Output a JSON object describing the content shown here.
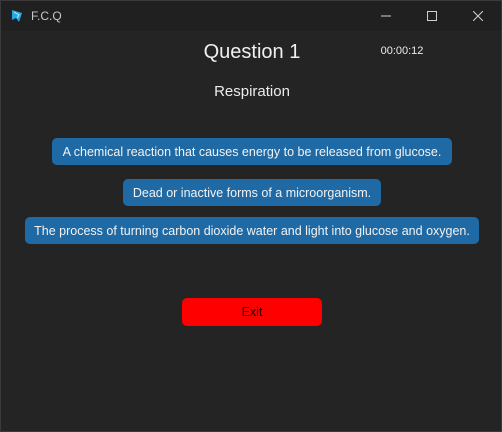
{
  "window": {
    "title": "F.C.Q",
    "icon": "feather-icon",
    "controls": [
      "minimize-icon",
      "maximize-icon",
      "close-icon"
    ]
  },
  "quiz": {
    "question_label": "Question 1",
    "timer": "00:00:12",
    "topic": "Respiration",
    "answers": [
      "A chemical reaction that causes energy to be released from glucose.",
      "Dead or inactive forms of a microorganism.",
      "The process of turning carbon dioxide water and light into glucose and oxygen."
    ],
    "exit_label": "Exit"
  },
  "colors": {
    "background": "#242424",
    "titlebar": "#202020",
    "answer_button": "#1f6aa5",
    "exit_button": "#ff0000"
  }
}
